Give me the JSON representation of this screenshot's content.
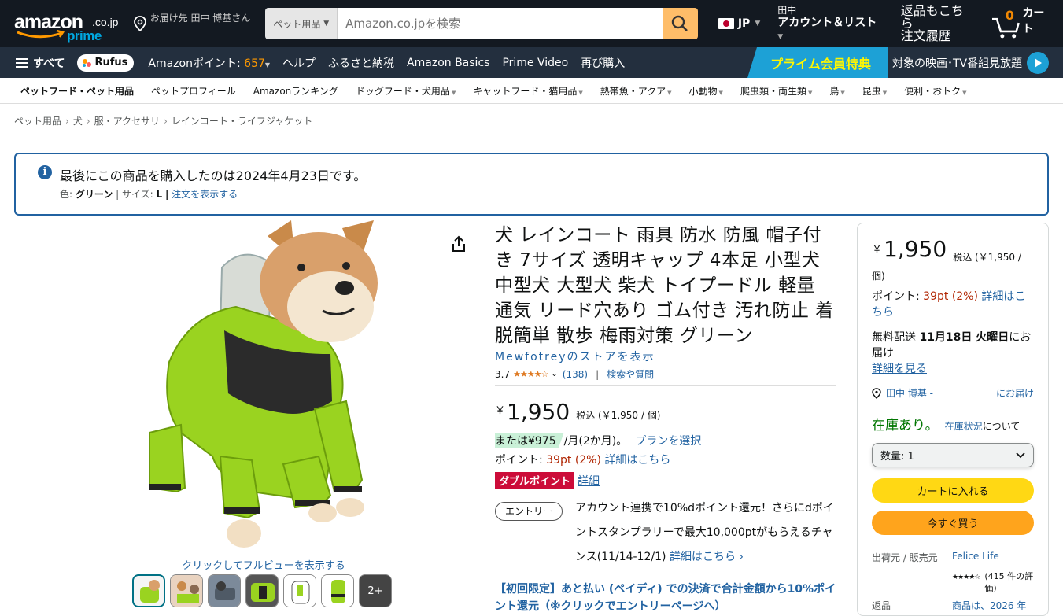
{
  "header": {
    "logo_word": "amazon",
    "logo_domain": ".co.jp",
    "logo_prime": "prime",
    "deliver_to": "お届け先 田中 博基さん",
    "search_category": "ペット用品",
    "search_placeholder": "Amazon.co.jpを検索",
    "lang": "JP",
    "account_top": "田中",
    "account_bottom": "アカウント＆リスト",
    "orders_top": "返品もこちら",
    "orders_bottom": "注文履歴",
    "cart_count": "0",
    "cart_label": "カート"
  },
  "nav": {
    "all": "すべて",
    "rufus": "Rufus",
    "points_label": "Amazonポイント:",
    "points_value": "657",
    "items": [
      "ヘルプ",
      "ふるさと納税",
      "Amazon Basics",
      "Prime Video",
      "再び購入"
    ],
    "prime_tag": "プライム会員特典",
    "prime_text": "対象の映画･TV番組見放題"
  },
  "subnav": [
    "ペットフード・ペット用品",
    "ペットプロフィール",
    "Amazonランキング",
    "ドッグフード・犬用品",
    "キャットフード・猫用品",
    "熱帯魚・アクア",
    "小動物",
    "爬虫類・両生類",
    "鳥",
    "昆虫",
    "便利・おトク"
  ],
  "breadcrumb": [
    "ペット用品",
    "犬",
    "服・アクセサリ",
    "レインコート・ライフジャケット"
  ],
  "notice": {
    "message": "最後にこの商品を購入したのは2024年4月23日です。",
    "color_label": "色:",
    "color_value": "グリーン",
    "size_label": "サイズ:",
    "size_value": "L",
    "order_link": "注文を表示する"
  },
  "gallery": {
    "fullview": "クリックしてフルビューを表示する",
    "more": "2+"
  },
  "product": {
    "title": "犬 レインコート 雨具 防水 防風 帽子付き 7サイズ 透明キャップ 4本足 小型犬 中型犬 大型犬 柴犬 トイプードル 軽量 通気 リード穴あり ゴム付き 汚れ防止 着脱簡単 散歩 梅雨対策 グリーン",
    "store": "Mewfotreyのストアを表示",
    "rating": "3.7",
    "stars": "★★★★☆",
    "reviews": "(138)",
    "search_qa": "検索や質問",
    "currency": "￥",
    "price": "1,950",
    "tax_note": "税込 (￥1,950 / 個)",
    "installment_hl": "または¥975",
    "installment_rest": "/月(2か月)。",
    "installment_link": "プランを選択",
    "points_label": "ポイント:",
    "points_value": "39pt  (2%)",
    "points_link": "詳細はこちら",
    "double_point": "ダブルポイント",
    "double_link": "詳細",
    "entry_pill": "エントリー",
    "entry_text": "アカウント連携で10%dポイント還元！さらにdポイントスタンプラリーで最大10,000ptがもらえるチャンス(11/14-12/1)",
    "entry_link": "詳細はこちら ›",
    "promo": "【初回限定】あと払い (ペイディ) での決済で合計金額から10%ポイント還元（※クリックでエントリーページへ）"
  },
  "buybox": {
    "currency": "￥",
    "price": "1,950",
    "tax_note": "税込 (￥1,950 /",
    "per_unit": "個)",
    "points_label": "ポイント:",
    "points_value": "39pt  (2%)",
    "points_link": "詳細はこちら",
    "ship_prefix": "無料配送",
    "ship_date": "11月18日 火曜日",
    "ship_suffix": "にお届け",
    "ship_link": "詳細を見る",
    "addr_name": "田中 博基 -",
    "addr_to": "にお届け",
    "stock": "在庫あり。",
    "stock_link": "在庫状況",
    "stock_suffix": "について",
    "qty": "数量: 1",
    "add_to_cart": "カートに入れる",
    "buy_now": "今すぐ買う",
    "seller_label": "出荷元 / 販売元",
    "seller_name": "Felice Life",
    "seller_stars": "★★★★☆",
    "seller_reviews": "(415 件の評価)",
    "returns_label": "返品",
    "returns_value": "商品は、2026 年"
  },
  "colors": {
    "nav_dark": "#131921",
    "nav_main": "#232f3e",
    "search_btn": "#febd69",
    "cart_btn": "#ffd814",
    "buy_btn": "#ffa41c",
    "link": "#2162a1",
    "prime_blue": "#1da1d6"
  }
}
